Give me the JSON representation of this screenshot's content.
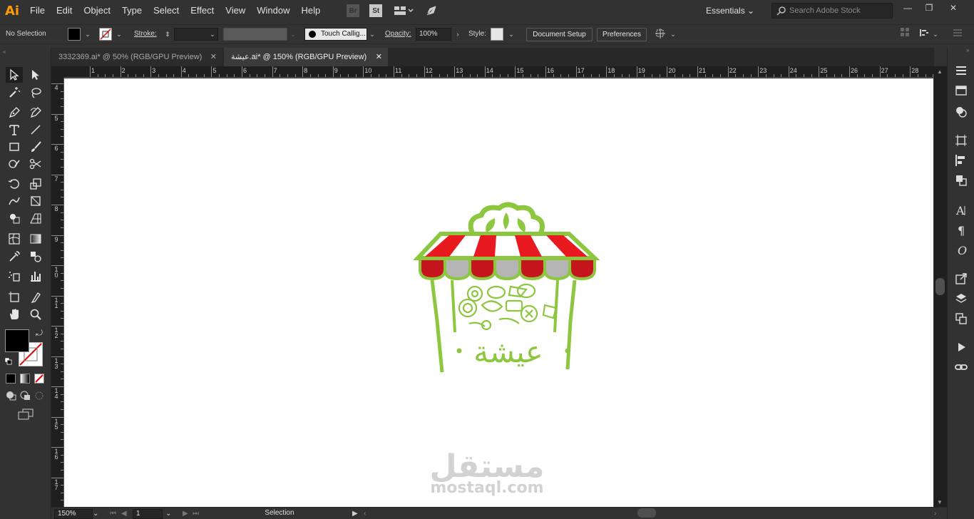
{
  "app": {
    "logo": "Ai"
  },
  "menu": [
    "File",
    "Edit",
    "Object",
    "Type",
    "Select",
    "Effect",
    "View",
    "Window",
    "Help"
  ],
  "menu_icons": {
    "bridge": "Br",
    "stock": "St"
  },
  "workspace": {
    "label": "Essentials"
  },
  "search": {
    "placeholder": "Search Adobe Stock"
  },
  "control": {
    "selection": "No Selection",
    "stroke_label": "Stroke:",
    "brush_name": "Touch Callig...",
    "opacity_label": "Opacity:",
    "opacity_value": "100%",
    "style_label": "Style:",
    "document_setup": "Document Setup",
    "preferences": "Preferences"
  },
  "tabs": [
    {
      "label": "3332369.ai* @ 50% (RGB/GPU Preview)",
      "active": false
    },
    {
      "label": "عيشة.ai* @ 150% (RGB/GPU Preview)",
      "active": true
    }
  ],
  "ruler_h": [
    "1",
    "2",
    "3",
    "4",
    "5",
    "6",
    "7",
    "8",
    "9",
    "10",
    "11",
    "12",
    "13",
    "14",
    "15",
    "16",
    "17",
    "18",
    "19",
    "20",
    "21",
    "22",
    "23",
    "24",
    "25",
    "26",
    "27",
    "28"
  ],
  "ruler_v": [
    "4",
    "5",
    "6",
    "7",
    "8",
    "9",
    "10",
    "11",
    "12",
    "13",
    "14",
    "15",
    "16",
    "17"
  ],
  "canvas": {
    "logo_text": "عيشة",
    "colors": {
      "green": "#8dc63f",
      "red": "#e8191f",
      "dark_red": "#c4161c",
      "grey": "#b5b5b5",
      "white": "#ffffff"
    }
  },
  "watermark": {
    "arabic": "مستقل",
    "latin": "mostaql.com"
  },
  "status": {
    "zoom": "150%",
    "artboard": "1",
    "tool": "Selection"
  },
  "colors": {
    "ui_bg": "#323232",
    "ui_dark": "#1f1f1f",
    "accent": "#ff9a00"
  }
}
